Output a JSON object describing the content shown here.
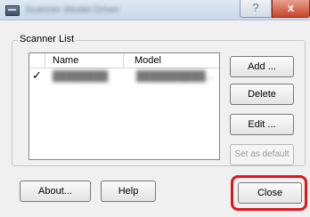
{
  "window": {
    "title": "Scanner Model Driver",
    "help_glyph": "?",
    "close_glyph": "x"
  },
  "group": {
    "label": "Scanner List"
  },
  "list": {
    "columns": [
      "",
      "Name",
      "Model"
    ],
    "rows": [
      {
        "check": "✓",
        "name": "████████",
        "model": "██████████..."
      }
    ]
  },
  "buttons": {
    "add": "Add ...",
    "delete": "Delete",
    "edit": "Edit ...",
    "set_default": "Set as default",
    "about": "About...",
    "help": "Help",
    "close": "Close"
  },
  "highlight_color": "#e0161b"
}
